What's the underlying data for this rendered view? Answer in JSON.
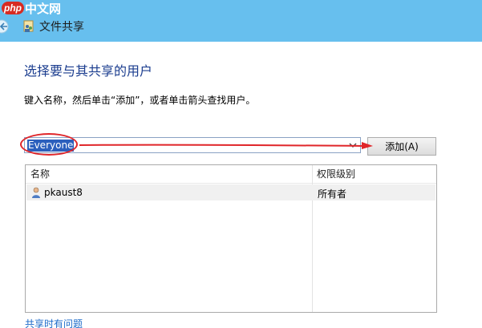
{
  "watermark": {
    "logo": "php",
    "text": "中文网"
  },
  "titlebar": {
    "title": "文件共享"
  },
  "heading": "选择要与其共享的用户",
  "instruction": "键入名称，然后单击“添加”，或者单击箭头查找用户。",
  "combo": {
    "value": "Everyone"
  },
  "add_button": "添加(A)",
  "listview": {
    "columns": [
      "名称",
      "权限级别"
    ],
    "rows": [
      {
        "name": "pkaust8",
        "level": "所有者"
      }
    ]
  },
  "footer_link": "共享时有问题",
  "colors": {
    "titlebar": "#67bfee",
    "heading": "#1b3d8f",
    "annotation": "#e0262a",
    "selection": "#2b5fbd"
  }
}
